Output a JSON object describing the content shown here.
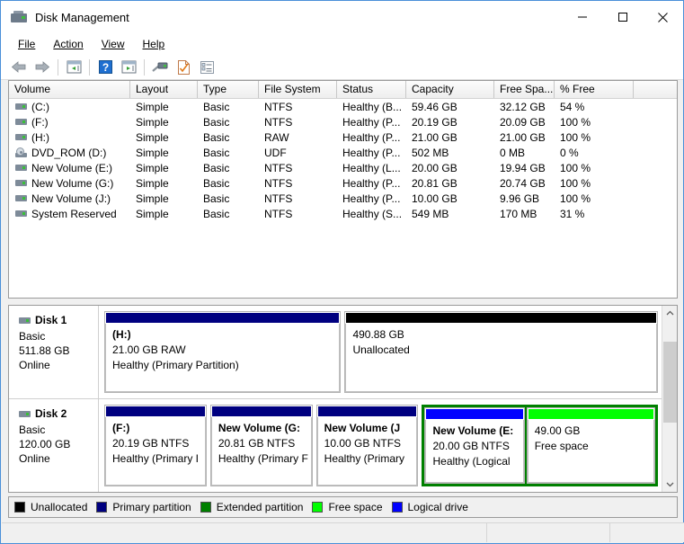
{
  "window": {
    "title": "Disk Management",
    "icon": "disk-management-icon",
    "buttons": {
      "minimize": "–",
      "maximize": "□",
      "close": "✕"
    }
  },
  "menu": {
    "items": [
      "File",
      "Action",
      "View",
      "Help"
    ]
  },
  "toolbar": {
    "items": [
      "back-arrow-icon",
      "forward-arrow-icon",
      "separator",
      "show-hide-console-tree-icon",
      "separator",
      "help-icon",
      "show-hide-action-pane-icon",
      "separator",
      "rescan-disks-icon",
      "properties-icon",
      "details-icon"
    ]
  },
  "volume_list": {
    "columns": [
      "Volume",
      "Layout",
      "Type",
      "File System",
      "Status",
      "Capacity",
      "Free Spa...",
      "% Free"
    ],
    "rows": [
      {
        "icon": "hard-drive-icon",
        "volume": "(C:)",
        "layout": "Simple",
        "type": "Basic",
        "fs": "NTFS",
        "status": "Healthy (B...",
        "capacity": "59.46 GB",
        "free": "32.12 GB",
        "pct": "54 %"
      },
      {
        "icon": "hard-drive-icon",
        "volume": "(F:)",
        "layout": "Simple",
        "type": "Basic",
        "fs": "NTFS",
        "status": "Healthy (P...",
        "capacity": "20.19 GB",
        "free": "20.09 GB",
        "pct": "100 %"
      },
      {
        "icon": "hard-drive-icon",
        "volume": "(H:)",
        "layout": "Simple",
        "type": "Basic",
        "fs": "RAW",
        "status": "Healthy (P...",
        "capacity": "21.00 GB",
        "free": "21.00 GB",
        "pct": "100 %"
      },
      {
        "icon": "cd-rom-icon",
        "volume": "DVD_ROM (D:)",
        "layout": "Simple",
        "type": "Basic",
        "fs": "UDF",
        "status": "Healthy (P...",
        "capacity": "502 MB",
        "free": "0 MB",
        "pct": "0 %"
      },
      {
        "icon": "hard-drive-icon",
        "volume": "New Volume (E:)",
        "layout": "Simple",
        "type": "Basic",
        "fs": "NTFS",
        "status": "Healthy (L...",
        "capacity": "20.00 GB",
        "free": "19.94 GB",
        "pct": "100 %"
      },
      {
        "icon": "hard-drive-icon",
        "volume": "New Volume (G:)",
        "layout": "Simple",
        "type": "Basic",
        "fs": "NTFS",
        "status": "Healthy (P...",
        "capacity": "20.81 GB",
        "free": "20.74 GB",
        "pct": "100 %"
      },
      {
        "icon": "hard-drive-icon",
        "volume": "New Volume (J:)",
        "layout": "Simple",
        "type": "Basic",
        "fs": "NTFS",
        "status": "Healthy (P...",
        "capacity": "10.00 GB",
        "free": "9.96 GB",
        "pct": "100 %"
      },
      {
        "icon": "hard-drive-icon",
        "volume": "System Reserved",
        "layout": "Simple",
        "type": "Basic",
        "fs": "NTFS",
        "status": "Healthy (S...",
        "capacity": "549 MB",
        "free": "170 MB",
        "pct": "31 %"
      }
    ]
  },
  "disks": [
    {
      "name": "Disk 1",
      "type": "Basic",
      "size": "511.88 GB",
      "state": "Online",
      "partitions": [
        {
          "title": "(H:)",
          "line2": "21.00 GB RAW",
          "line3": "Healthy (Primary Partition)",
          "bar_color": "#000080",
          "width_pct": 43,
          "kind": "primary"
        },
        {
          "title": "",
          "line2": "490.88 GB",
          "line3": "Unallocated",
          "bar_color": "#000000",
          "width_pct": 57,
          "kind": "unallocated"
        }
      ]
    },
    {
      "name": "Disk 2",
      "type": "Basic",
      "size": "120.00 GB",
      "state": "Online",
      "partitions": [
        {
          "title": "(F:)",
          "line2": "20.19 GB NTFS",
          "line3": "Healthy (Primary I",
          "bar_color": "#000080",
          "width_pct": 17,
          "kind": "primary"
        },
        {
          "title": "New Volume  (G:",
          "line2": "20.81 GB NTFS",
          "line3": "Healthy (Primary F",
          "bar_color": "#000080",
          "width_pct": 17,
          "kind": "primary"
        },
        {
          "title": "New Volume  (J",
          "line2": "10.00 GB NTFS",
          "line3": "Healthy (Primary",
          "bar_color": "#000080",
          "width_pct": 17,
          "kind": "primary"
        },
        {
          "title": "New Volume  (E:",
          "line2": "20.00 GB NTFS",
          "line3": "Healthy (Logical",
          "bar_color": "#0000ff",
          "width_pct": 17,
          "kind": "logical"
        },
        {
          "title": "",
          "line2": "49.00 GB",
          "line3": "Free space",
          "bar_color": "#00ff00",
          "width_pct": 22,
          "kind": "free"
        }
      ]
    }
  ],
  "legend": {
    "items": [
      {
        "label": "Unallocated",
        "color": "#000000"
      },
      {
        "label": "Primary partition",
        "color": "#000080"
      },
      {
        "label": "Extended partition",
        "color": "#008000"
      },
      {
        "label": "Free space",
        "color": "#00ff00"
      },
      {
        "label": "Logical drive",
        "color": "#0000ff"
      }
    ]
  },
  "statusbar": {
    "left": "",
    "middle": "",
    "right": ""
  },
  "colors": {
    "accent": "#4a90d9",
    "primary": "#000080",
    "logical": "#0000ff",
    "free": "#00ff00",
    "extended": "#008000",
    "unallocated": "#000000"
  }
}
